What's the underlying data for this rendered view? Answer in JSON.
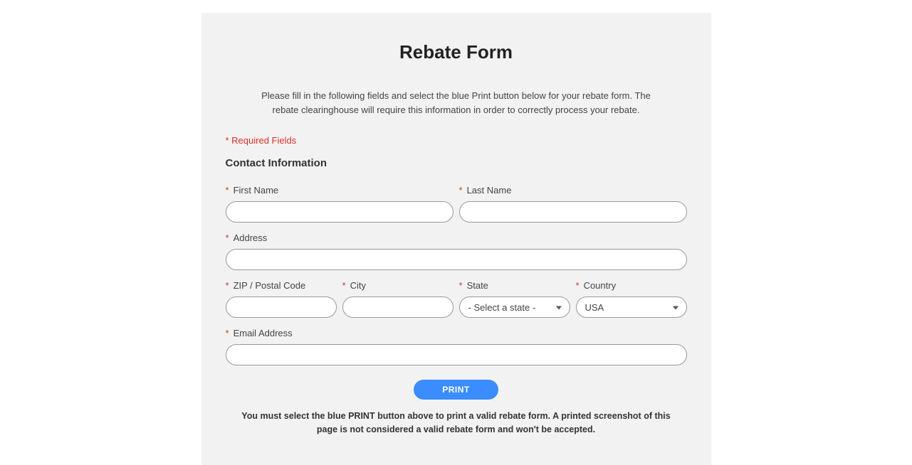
{
  "title": "Rebate Form",
  "intro": "Please fill in the following fields and select the blue Print button below for your rebate form. The rebate clearinghouse will require this information in order to correctly process your rebate.",
  "required_note": "* Required Fields",
  "section_heading": "Contact Information",
  "fields": {
    "first_name_label": "First Name",
    "last_name_label": "Last Name",
    "address_label": "Address",
    "zip_label": "ZIP / Postal Code",
    "city_label": "City",
    "state_label": "State",
    "state_placeholder": "- Select a state -",
    "country_label": "Country",
    "country_value": "USA",
    "email_label": "Email Address"
  },
  "print_label": "PRINT",
  "footer_note": "You must select the blue PRINT button above to print a valid rebate form. A printed screenshot of this page is not considered a valid rebate form and won't be accepted."
}
